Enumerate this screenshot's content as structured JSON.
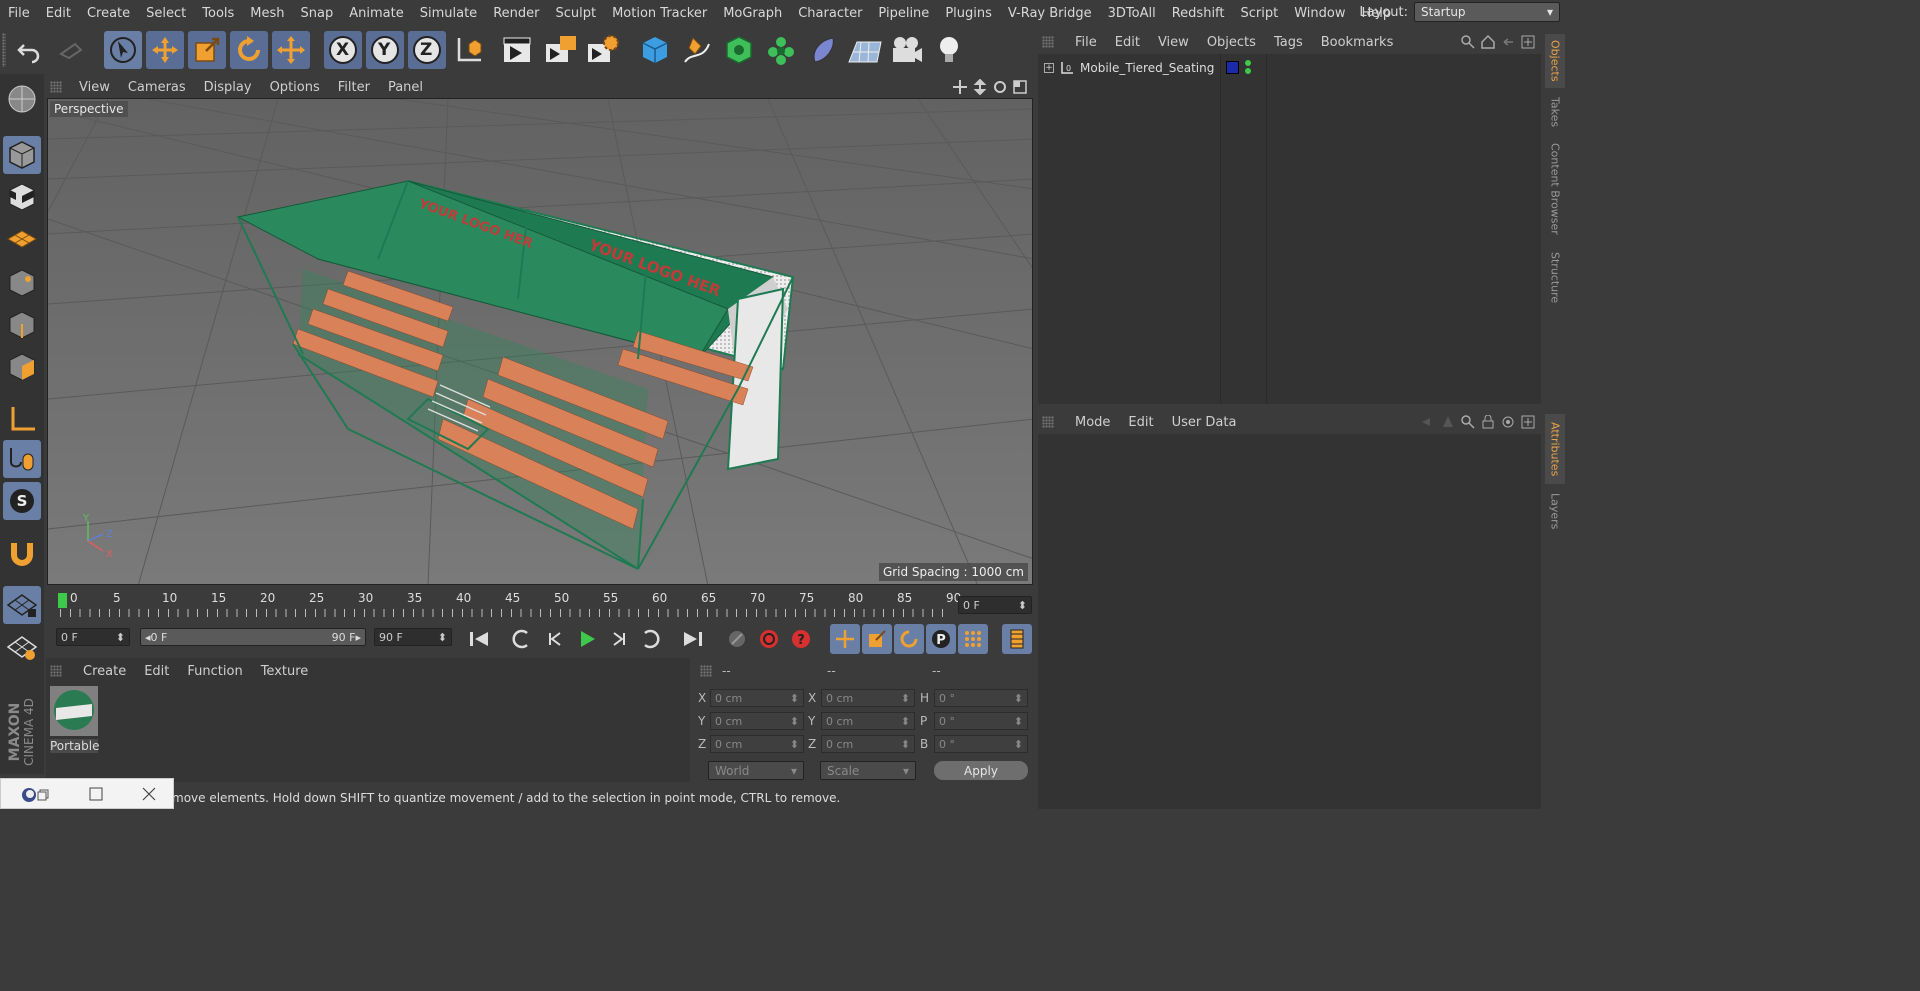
{
  "menubar": {
    "items": [
      "File",
      "Edit",
      "Create",
      "Select",
      "Tools",
      "Mesh",
      "Snap",
      "Animate",
      "Simulate",
      "Render",
      "Sculpt",
      "Motion Tracker",
      "MoGraph",
      "Character",
      "Pipeline",
      "Plugins",
      "V-Ray Bridge",
      "3DToAll",
      "Redshift",
      "Script",
      "Window",
      "Help"
    ],
    "layout_label": "Layout:",
    "layout_value": "Startup"
  },
  "toolbar": {
    "icons": [
      "undo-icon",
      "redo-icon",
      "live-selection-icon",
      "move-icon",
      "scale-icon",
      "rotate-icon",
      "recent-tool-icon",
      "x-axis-lock-icon",
      "y-axis-lock-icon",
      "z-axis-lock-icon",
      "coordinate-system-icon",
      "render-view-icon",
      "render-picture-viewer-icon",
      "render-settings-icon",
      "cube-primitive-icon",
      "pen-spline-icon",
      "subdivision-surface-icon",
      "cloner-icon",
      "deformer-icon",
      "floor-icon",
      "camera-icon",
      "light-icon"
    ],
    "axis_labels": [
      "X",
      "Y",
      "Z"
    ]
  },
  "leftbar": {
    "icons": [
      "sphere-mode-icon",
      "model-mode-icon",
      "texture-mode-icon",
      "workplane-icon",
      "points-mode-icon",
      "edges-mode-icon",
      "polygons-mode-icon",
      "axis-mode-icon",
      "tweak-mode-icon",
      "solo-mode-icon",
      "magnet-icon",
      "grid-snap-icon",
      "lock-workplane-icon"
    ]
  },
  "viewport": {
    "menu": [
      "View",
      "Cameras",
      "Display",
      "Options",
      "Filter",
      "Panel"
    ],
    "label": "Perspective",
    "grid_spacing": "Grid Spacing : 1000 cm",
    "banner_text_1": "YOUR LOGO HER",
    "banner_text_2": "YOUR LOGO HER",
    "axis_y": "Y",
    "axis_z": "Z",
    "axis_x": "X"
  },
  "timeline": {
    "ticks": [
      "0",
      "5",
      "10",
      "15",
      "20",
      "25",
      "30",
      "35",
      "40",
      "45",
      "50",
      "55",
      "60",
      "65",
      "70",
      "75",
      "80",
      "85",
      "90"
    ],
    "current_frame": "0 F"
  },
  "transport": {
    "start_frame": "0 F",
    "range_start": "0 F",
    "range_end": "90 F",
    "end_frame": "90 F"
  },
  "material_panel": {
    "menu": [
      "Create",
      "Edit",
      "Function",
      "Texture"
    ],
    "material_name": "Portable"
  },
  "coord_panel": {
    "headers": [
      "--",
      "--",
      "--"
    ],
    "pos": {
      "x": "0 cm",
      "y": "0 cm",
      "z": "0 cm"
    },
    "size": {
      "x": "0 cm",
      "y": "0 cm",
      "z": "0 cm"
    },
    "rot": {
      "h": "0 °",
      "p": "0 °",
      "b": "0 °"
    },
    "row_labels": [
      "X",
      "Y",
      "Z"
    ],
    "rot_labels": [
      "H",
      "P",
      "B"
    ],
    "space_value": "World",
    "mode_value": "Scale",
    "apply_label": "Apply"
  },
  "status": {
    "text": "move elements. Hold down SHIFT to quantize movement / add to the selection in point mode, CTRL to remove."
  },
  "object_manager": {
    "menu": [
      "File",
      "Edit",
      "View",
      "Objects",
      "Tags",
      "Bookmarks"
    ],
    "object_name": "Mobile_Tiered_Seating"
  },
  "attribute_manager": {
    "menu": [
      "Mode",
      "Edit",
      "User Data"
    ]
  },
  "right_tabs": {
    "top": [
      "Objects",
      "Takes",
      "Content Browser",
      "Structure"
    ],
    "bottom": [
      "Attributes",
      "Layers"
    ]
  },
  "brand": {
    "maxon": "MAXON",
    "product": "CINEMA 4D"
  },
  "colors": {
    "accent_blue": "#6a7fa5",
    "seat": "#d9825a",
    "structure_green": "#1f7a52",
    "play_green": "#3fc94a"
  }
}
